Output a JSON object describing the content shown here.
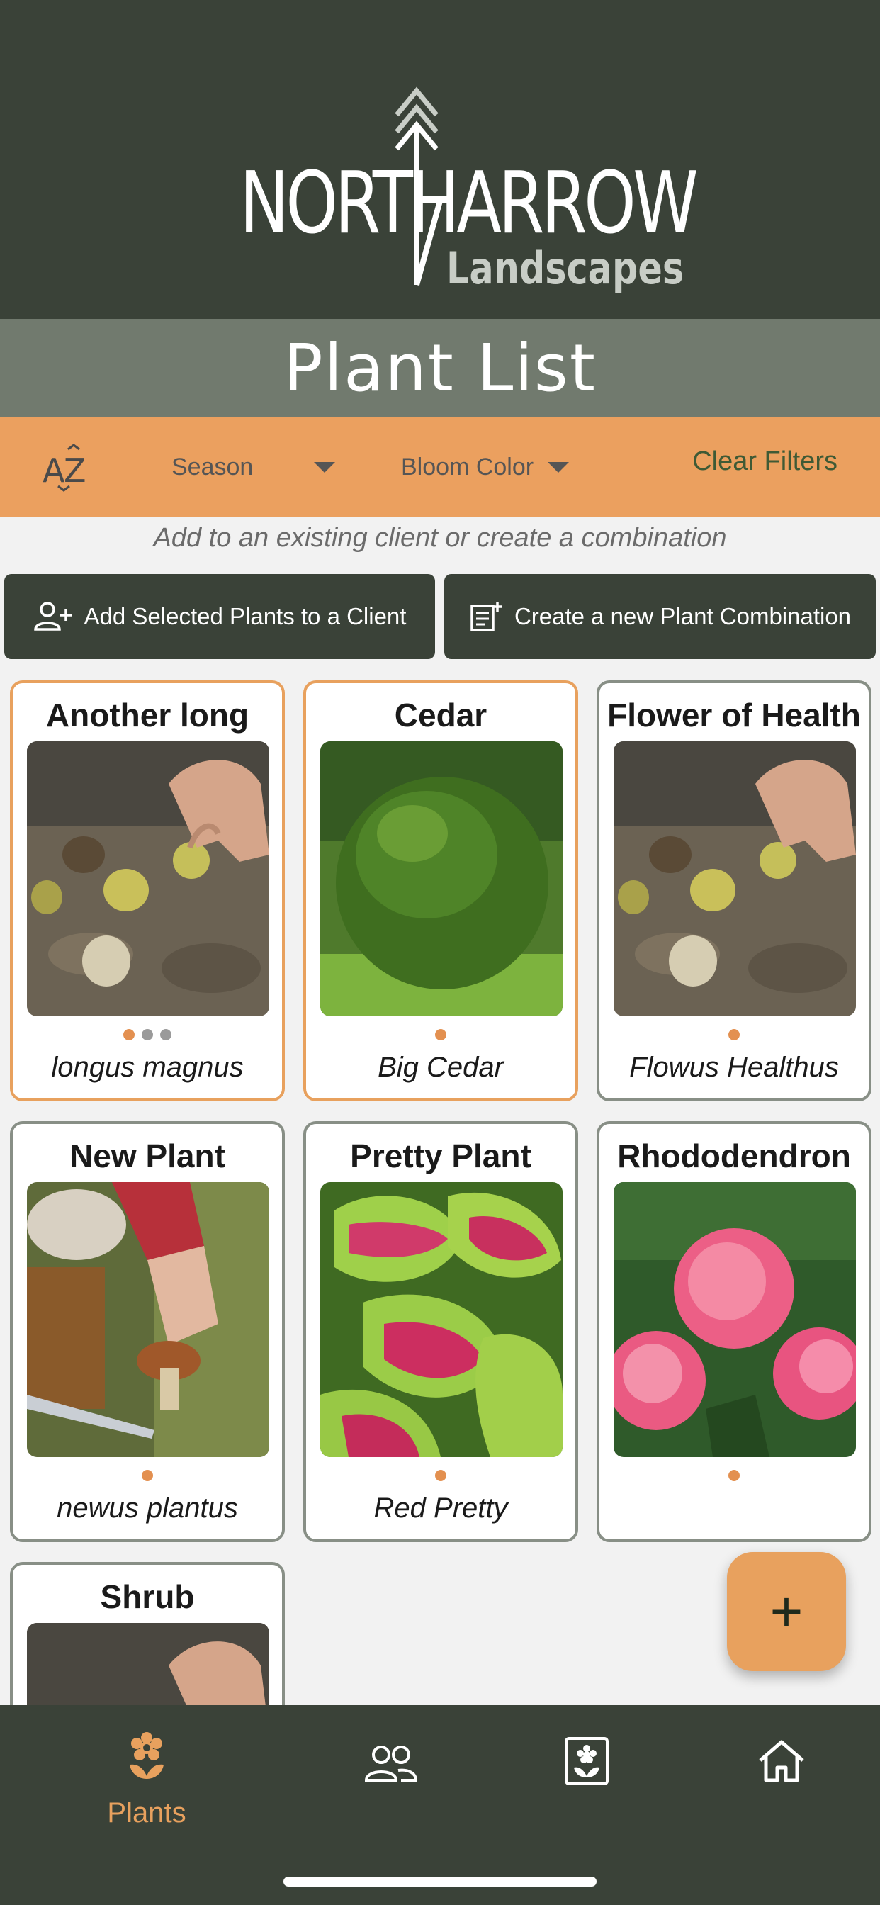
{
  "brand": {
    "name_main": "NORTHARROW",
    "name_sub": "Landscapes"
  },
  "page_title": "Plant List",
  "filters": {
    "sort_label": "AZ",
    "season_label": "Season",
    "bloom_color_label": "Bloom Color",
    "clear_label": "Clear Filters"
  },
  "hint": "Add to an existing client or create a combination",
  "actions": {
    "add_to_client": "Add Selected Plants to a Client",
    "create_combination": "Create a new Plant Combination"
  },
  "plants": [
    {
      "name": "Another long",
      "scientific": "longus magnus",
      "selected": true,
      "dots": 3,
      "photo": "walnuts-in-soil"
    },
    {
      "name": "Cedar",
      "scientific": "Big Cedar",
      "selected": true,
      "dots": 1,
      "photo": "round-shrub"
    },
    {
      "name": "Flower of Health",
      "scientific": "Flowus Healthus",
      "selected": false,
      "dots": 1,
      "photo": "walnuts-in-soil"
    },
    {
      "name": "New Plant",
      "scientific": "newus plantus",
      "selected": false,
      "dots": 1,
      "photo": "mushroom-forager"
    },
    {
      "name": "Pretty Plant",
      "scientific": "Red Pretty",
      "selected": false,
      "dots": 1,
      "photo": "coleus-leaves"
    },
    {
      "name": "Rhododendron",
      "scientific": "",
      "selected": false,
      "dots": 1,
      "photo": "pink-rhododendron"
    },
    {
      "name": "Shrub",
      "scientific": "",
      "selected": false,
      "dots": 0,
      "photo": "walnuts-in-soil"
    }
  ],
  "fab": {
    "label": "+"
  },
  "nav": {
    "plants_label": "Plants",
    "icons": [
      "flower-icon",
      "people-icon",
      "plant-book-icon",
      "home-icon"
    ]
  },
  "colors": {
    "header_bg": "#3a4238",
    "title_band": "#717a6e",
    "accent_orange": "#eba05f",
    "selected_border": "#e8a15e",
    "card_border": "#888f86"
  }
}
